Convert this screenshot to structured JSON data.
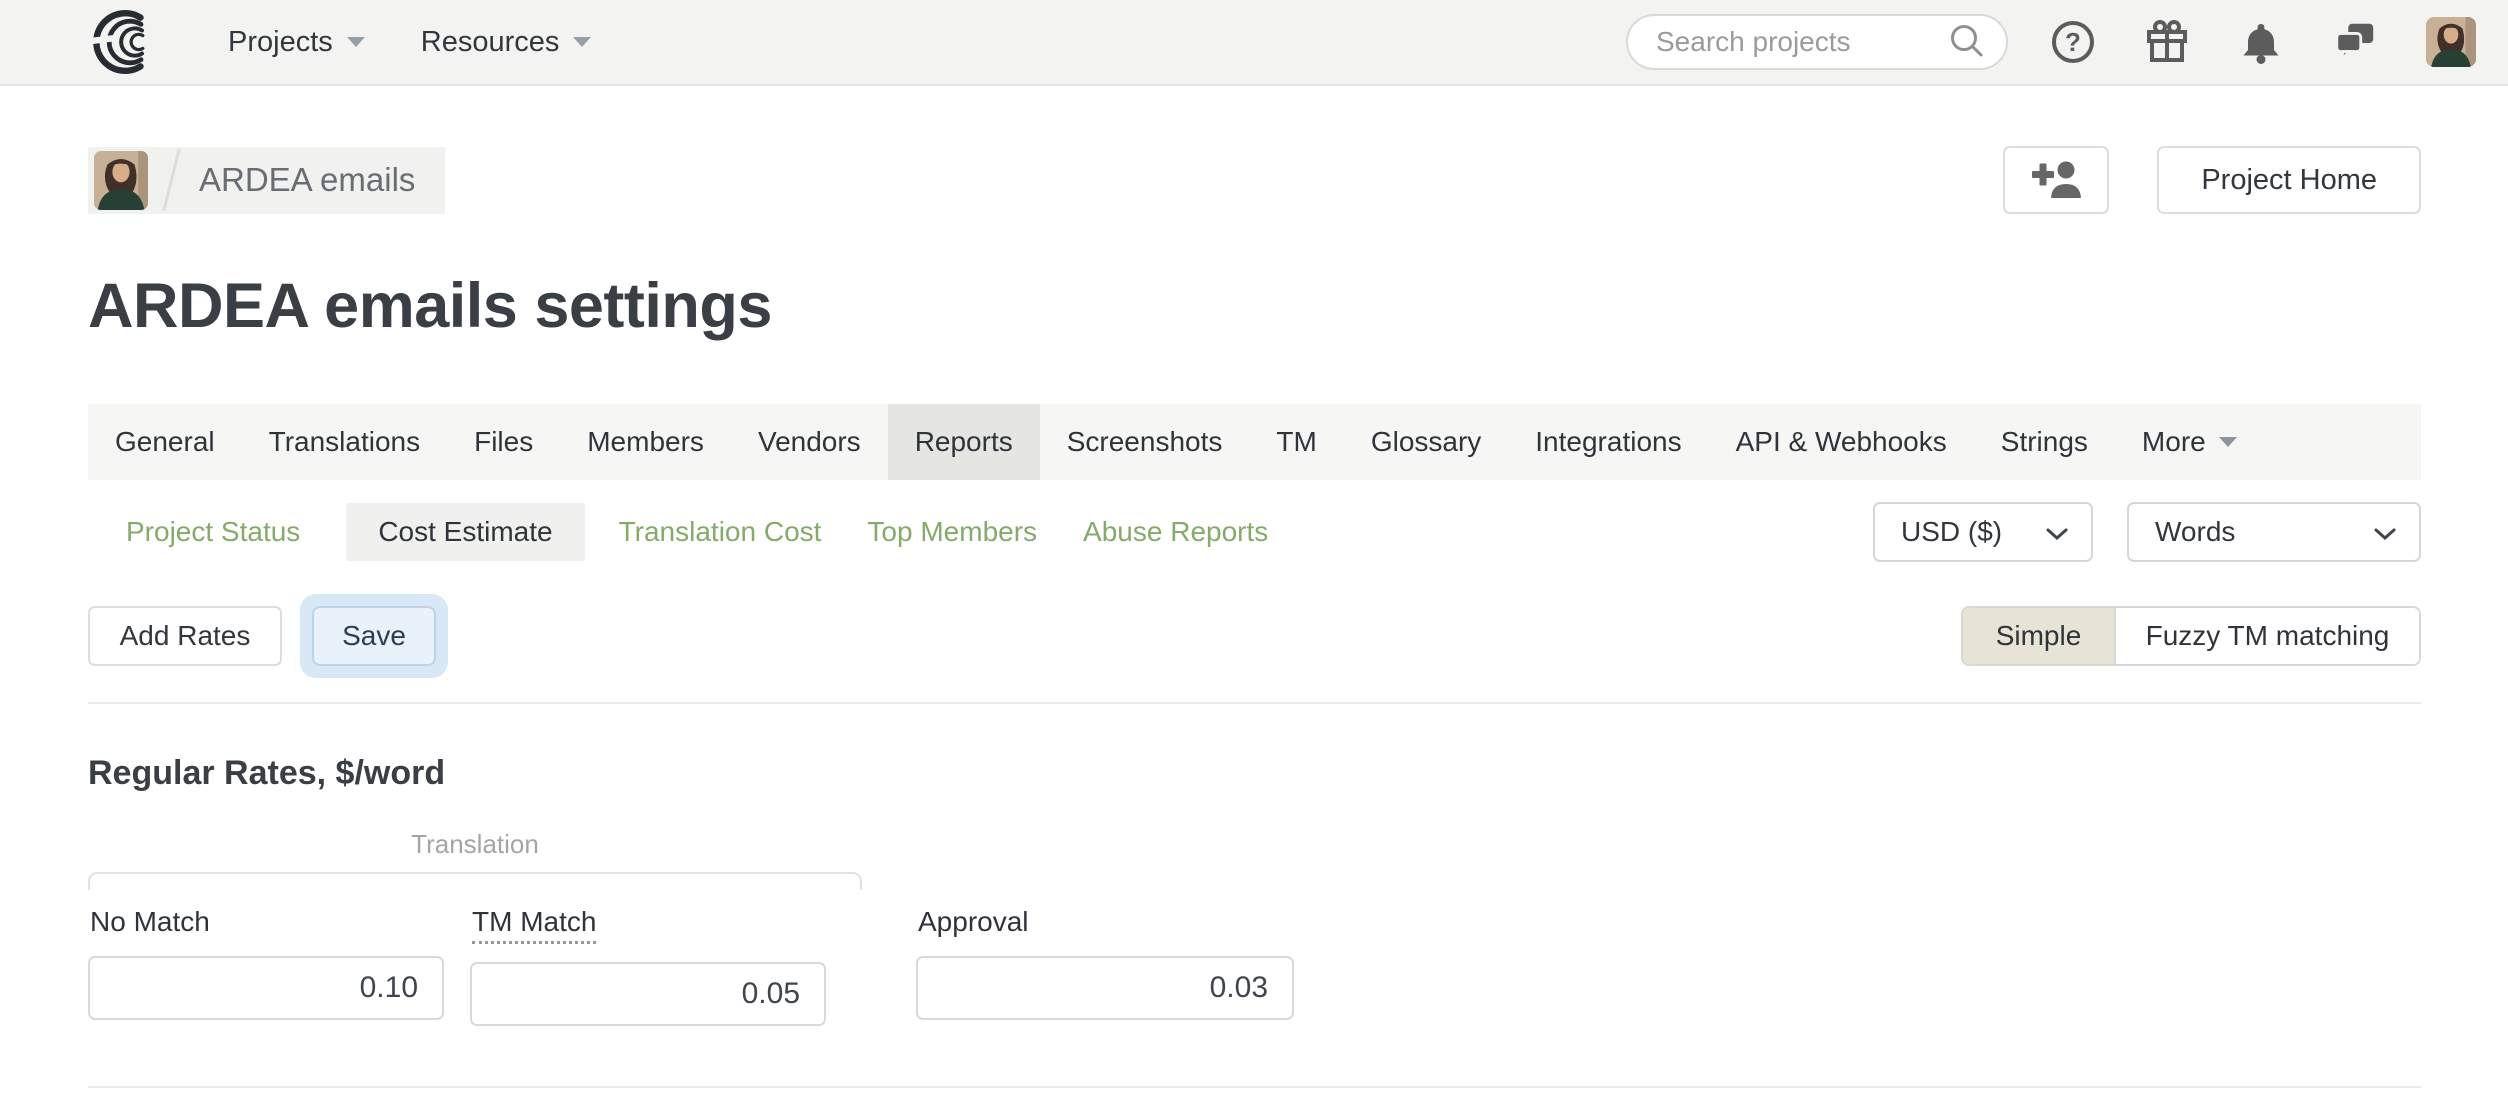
{
  "colors": {
    "accent_green": "#85aa6a",
    "focus_blue_halo": "#d8e8f6",
    "selected_tab_gray": "#e5e5e2",
    "selected_mode_beige": "#e7e3d5",
    "topbar_bg": "#f3f3f2"
  },
  "topbar": {
    "logo_icon": "crowdin-logo",
    "nav": [
      {
        "label": "Projects"
      },
      {
        "label": "Resources"
      }
    ],
    "search": {
      "placeholder": "Search projects",
      "icon": "search-icon"
    },
    "icons": [
      "help-icon",
      "gift-icon",
      "bell-icon",
      "chat-icon",
      "user-avatar"
    ]
  },
  "breadcrumb": {
    "project_name": "ARDEA emails"
  },
  "page_header": {
    "title": "ARDEA emails settings",
    "invite_icon": "add-person-icon",
    "project_home_label": "Project Home"
  },
  "tabs": {
    "selected": "Reports",
    "items": [
      {
        "label": "General"
      },
      {
        "label": "Translations"
      },
      {
        "label": "Files"
      },
      {
        "label": "Members"
      },
      {
        "label": "Vendors"
      },
      {
        "label": "Reports"
      },
      {
        "label": "Screenshots"
      },
      {
        "label": "TM"
      },
      {
        "label": "Glossary"
      },
      {
        "label": "Integrations"
      },
      {
        "label": "API & Webhooks"
      },
      {
        "label": "Strings"
      },
      {
        "label": "More"
      }
    ]
  },
  "subnav": {
    "selected": "Cost Estimate",
    "items": [
      {
        "label": "Project Status"
      },
      {
        "label": "Cost Estimate"
      },
      {
        "label": "Translation Cost"
      },
      {
        "label": "Top Members"
      },
      {
        "label": "Abuse Reports"
      }
    ]
  },
  "filters": {
    "currency_value": "USD ($)",
    "unit_value": "Words"
  },
  "actions": {
    "add_rates_label": "Add Rates",
    "save_label": "Save"
  },
  "mode_toggle": {
    "selected": "Simple",
    "options": [
      {
        "label": "Simple"
      },
      {
        "label": "Fuzzy TM matching"
      }
    ]
  },
  "rates": {
    "heading": "Regular Rates, $/word",
    "group_label": "Translation",
    "fields": [
      {
        "label": "No Match",
        "value": "0.10"
      },
      {
        "label": "TM Match",
        "value": "0.05"
      },
      {
        "label": "Approval",
        "value": "0.03"
      }
    ]
  }
}
